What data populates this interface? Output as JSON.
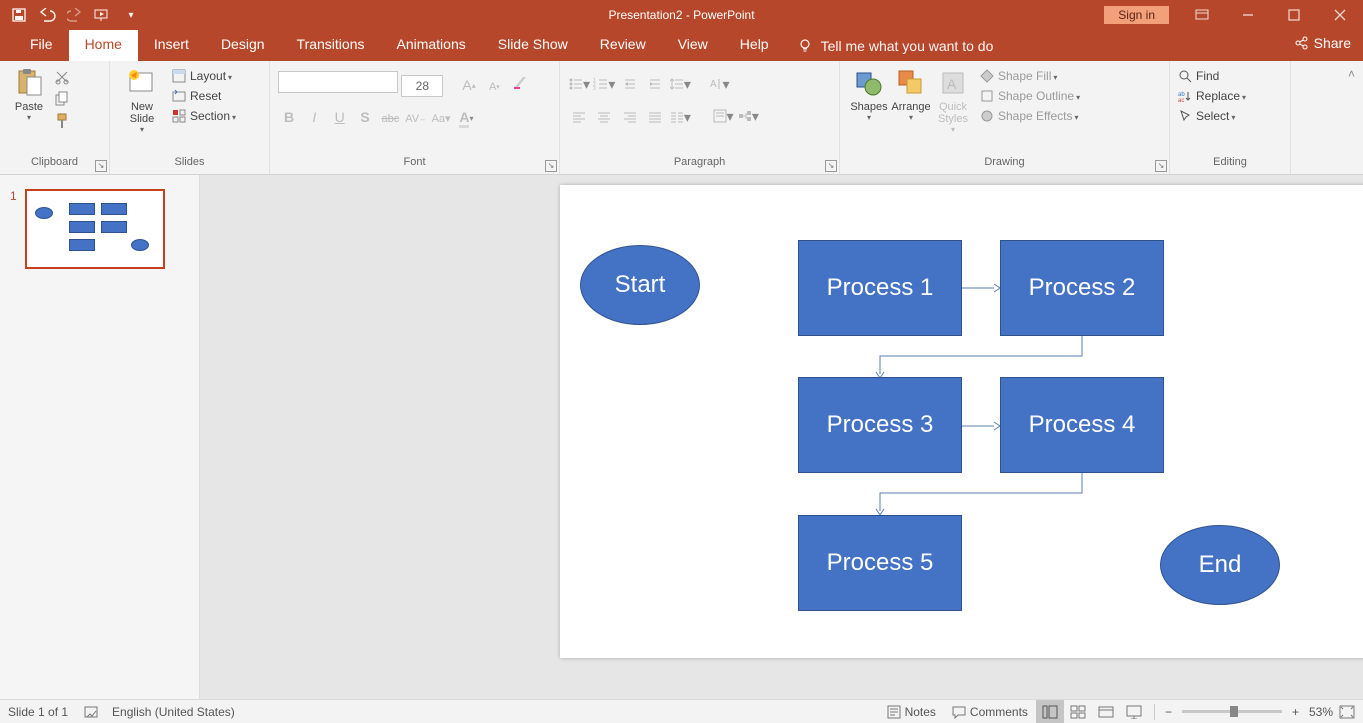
{
  "title": "Presentation2 - PowerPoint",
  "signin": "Sign in",
  "menu": {
    "file": "File",
    "home": "Home",
    "insert": "Insert",
    "design": "Design",
    "transitions": "Transitions",
    "animations": "Animations",
    "slideshow": "Slide Show",
    "review": "Review",
    "view": "View",
    "help": "Help",
    "tellme": "Tell me what you want to do",
    "share": "Share"
  },
  "ribbon": {
    "clipboard": {
      "label": "Clipboard",
      "paste": "Paste"
    },
    "slides": {
      "label": "Slides",
      "newslide": "New\nSlide",
      "layout": "Layout",
      "reset": "Reset",
      "section": "Section"
    },
    "font": {
      "label": "Font",
      "size": "28"
    },
    "paragraph": {
      "label": "Paragraph"
    },
    "drawing": {
      "label": "Drawing",
      "shapes": "Shapes",
      "arrange": "Arrange",
      "quick": "Quick\nStyles",
      "fill": "Shape Fill",
      "outline": "Shape Outline",
      "effects": "Shape Effects"
    },
    "editing": {
      "label": "Editing",
      "find": "Find",
      "replace": "Replace",
      "select": "Select"
    }
  },
  "slide": {
    "start": "Start",
    "p1": "Process 1",
    "p2": "Process 2",
    "p3": "Process 3",
    "p4": "Process 4",
    "p5": "Process 5",
    "end": "End"
  },
  "thumb": {
    "num": "1"
  },
  "status": {
    "slide": "Slide 1 of 1",
    "lang": "English (United States)",
    "notes": "Notes",
    "comments": "Comments",
    "zoom": "53%"
  }
}
